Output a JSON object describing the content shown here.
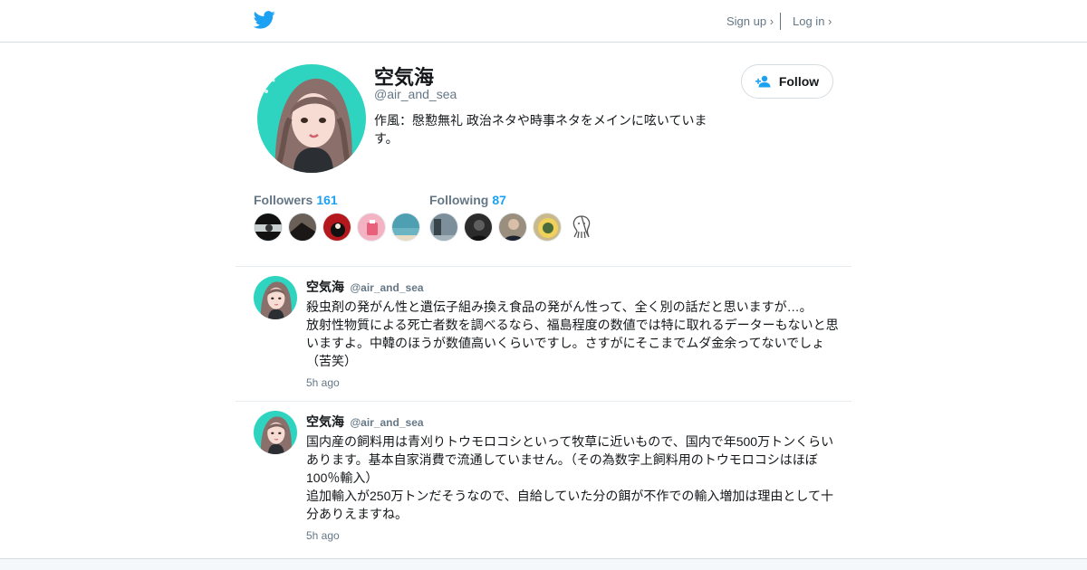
{
  "header": {
    "signup_label": "Sign up ›",
    "login_label": "Log in ›",
    "brand_color": "#1da1f2",
    "logo_icon": "twitter-bird-icon"
  },
  "profile": {
    "name": "空気海",
    "handle": "@air_and_sea",
    "bio": "作風：慇懃無礼 政治ネタや時事ネタをメインに呟いています。",
    "follow_label": "Follow",
    "followers_label": "Followers",
    "followers_count": "161",
    "following_label": "Following",
    "following_count": "87"
  },
  "tweets": [
    {
      "name": "空気海",
      "handle": "@air_and_sea",
      "text": "殺虫剤の発がん性と遺伝子組み換え食品の発がん性って、全く別の話だと思いますが…。\n放射性物質による死亡者数を調べるなら、福島程度の数値では特に取れるデーターもないと思いますよ。中韓のほうが数値高いくらいですし。さすがにそこまでムダ金余ってないでしょ（苦笑）",
      "time": "5h ago"
    },
    {
      "name": "空気海",
      "handle": "@air_and_sea",
      "text": "国内産の飼料用は青刈りトウモロコシといって牧草に近いもので、国内で年500万トンくらいあります。基本自家消費で流通していません。（その為数字上飼料用のトウモロコシはほぼ100％輸入）\n追加輸入が250万トンだそうなので、自給していた分の餌が不作での輸入増加は理由として十分ありえますね。",
      "time": "5h ago"
    }
  ]
}
